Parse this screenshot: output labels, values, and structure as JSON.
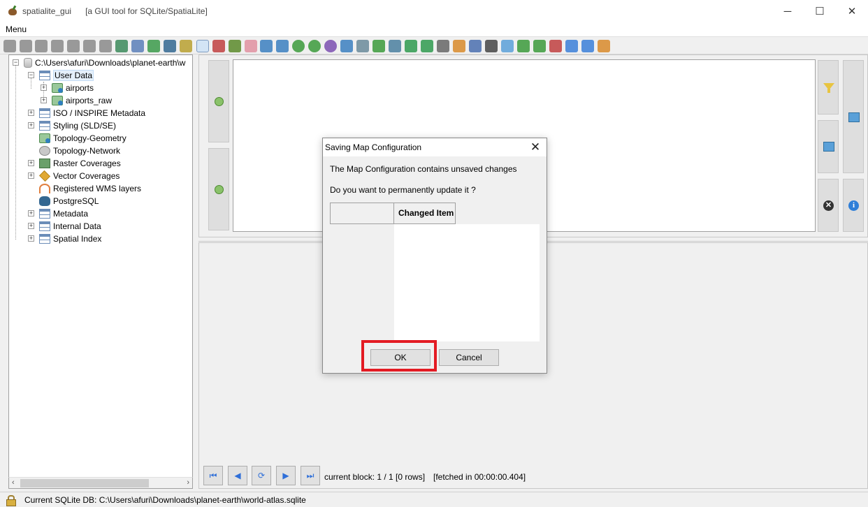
{
  "window": {
    "title": "spatialite_gui",
    "subtitle": "[a GUI tool for SQLite/SpatiaLite]",
    "minimize": "─",
    "maximize": "☐",
    "close": "✕"
  },
  "menubar": {
    "menu": "Menu"
  },
  "toolbar": {
    "icons": [
      "connect-icon",
      "disconnect-icon",
      "create-db-icon",
      "memory-db-icon",
      "save-memory-db-icon",
      "clone-db-icon",
      "export-icon",
      "vacuum-icon",
      "sql-script-icon",
      "load-shapefile-icon",
      "postgresql-icon",
      "raster-icon",
      "table-icon",
      "chart-icon",
      "bug-icon",
      "brain-icon",
      "import-icon",
      "export-data-icon",
      "globe-icon",
      "globe2-icon",
      "globe3-icon",
      "map-icon",
      "print-icon",
      "layer-icon",
      "layer2-icon",
      "excel-icon",
      "spreadsheet-icon",
      "eye-icon",
      "styles-icon",
      "copy-icon",
      "list-icon",
      "wms-icon",
      "network-icon",
      "checkpoint-icon",
      "a-icon",
      "info-icon",
      "help-icon",
      "exit-icon"
    ]
  },
  "tree": {
    "root": "C:\\Users\\afuri\\Downloads\\planet-earth\\w",
    "items": [
      {
        "label": "User Data"
      },
      {
        "label": "airports"
      },
      {
        "label": "airports_raw"
      },
      {
        "label": "ISO / INSPIRE Metadata"
      },
      {
        "label": "Styling (SLD/SE)"
      },
      {
        "label": "Topology-Geometry"
      },
      {
        "label": "Topology-Network"
      },
      {
        "label": "Raster Coverages"
      },
      {
        "label": "Vector Coverages"
      },
      {
        "label": "Registered WMS layers"
      },
      {
        "label": "PostgreSQL"
      },
      {
        "label": "Metadata"
      },
      {
        "label": "Internal Data"
      },
      {
        "label": "Spatial Index"
      }
    ],
    "expander_plus": "+",
    "expander_minus": "−",
    "scroll_left": "‹",
    "scroll_right": "›"
  },
  "results": {
    "block_info": "current block: 1 / 1 [0 rows]",
    "fetch_info": "[fetched in 00:00:00.404]",
    "nav": {
      "first": "⏮",
      "prev": "◀",
      "refresh": "⟳",
      "next": "▶",
      "last": "⏭"
    }
  },
  "sql_panel": {
    "clear": "✕",
    "info": "i"
  },
  "statusbar": {
    "text": "Current SQLite DB: C:\\Users\\afuri\\Downloads\\planet-earth\\world-atlas.sqlite"
  },
  "dialog": {
    "title": "Saving Map Configuration",
    "close": "✕",
    "message1": "The Map Configuration contains unsaved changes",
    "message2": "Do you want to permanently update it ?",
    "column_header": "Changed Item",
    "ok": "OK",
    "cancel": "Cancel"
  },
  "colors": {
    "highlight": "#e31b23",
    "accent": "#2f6fd8"
  }
}
